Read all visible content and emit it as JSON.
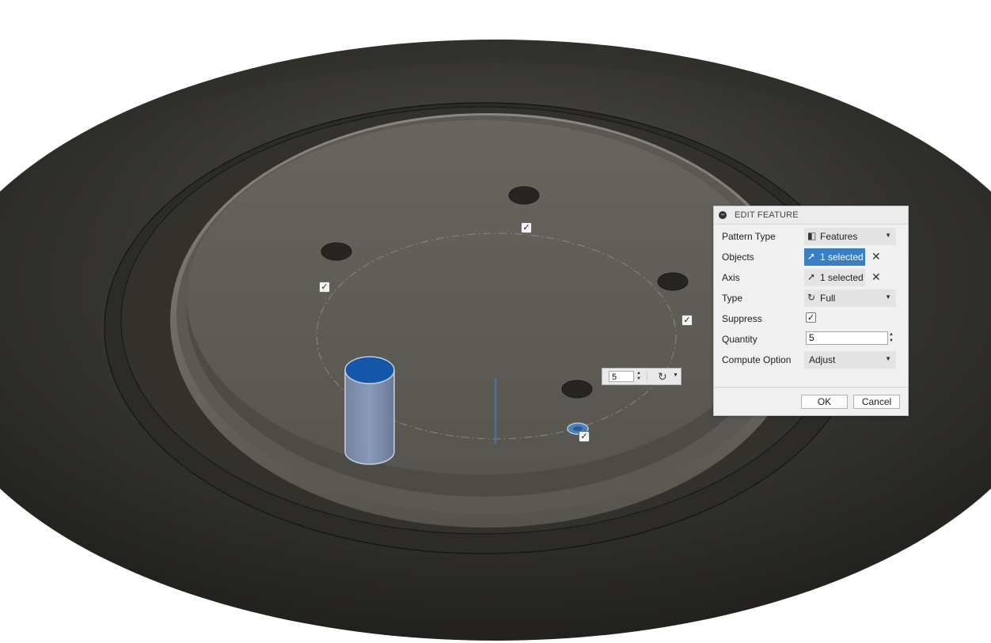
{
  "dialog": {
    "title": "EDIT FEATURE",
    "rows": {
      "pattern_type": {
        "label": "Pattern Type",
        "value": "Features",
        "icon": "feature-icon"
      },
      "objects": {
        "label": "Objects",
        "value": "1 selected",
        "icon": "cursor-arrow-icon",
        "highlight": "#3a7fc4"
      },
      "axis": {
        "label": "Axis",
        "value": "1 selected",
        "icon": "cursor-arrow-icon"
      },
      "type": {
        "label": "Type",
        "value": "Full",
        "icon": "rotate-icon"
      },
      "suppress": {
        "label": "Suppress",
        "checked": true
      },
      "quantity": {
        "label": "Quantity",
        "value": "5"
      },
      "compute_option": {
        "label": "Compute Option",
        "value": "Adjust"
      }
    },
    "buttons": {
      "ok": "OK",
      "cancel": "Cancel"
    }
  },
  "viewport": {
    "inline_quantity": "5",
    "instance_checkboxes_checked": 5,
    "body_color": "#2b2a26",
    "plate_color": "#5f5d56",
    "cylinder_cap_color": "#1456a8"
  }
}
